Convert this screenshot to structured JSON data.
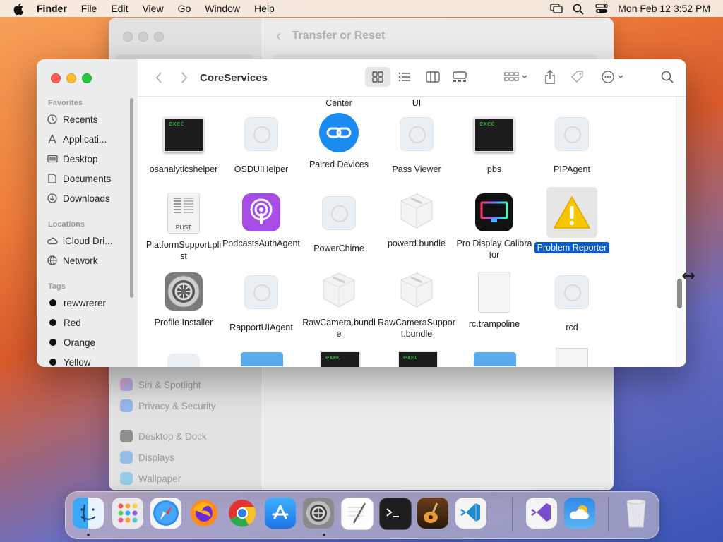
{
  "menubar": {
    "app_name": "Finder",
    "items": [
      "File",
      "Edit",
      "View",
      "Go",
      "Window",
      "Help"
    ],
    "clock": "Mon Feb 12  3:52 PM"
  },
  "settings_window": {
    "title": "Transfer or Reset",
    "sidebar_items": [
      {
        "label": "Siri & Spotlight",
        "color": "#c070e0"
      },
      {
        "label": "Privacy & Security",
        "color": "#4a8df0"
      },
      {
        "label": "Desktop & Dock",
        "color": "#2b2b2b"
      },
      {
        "label": "Displays",
        "color": "#3a8ef0"
      },
      {
        "label": "Wallpaper",
        "color": "#3ab0e8"
      }
    ]
  },
  "finder": {
    "title": "CoreServices",
    "sidebar": {
      "favorites_heading": "Favorites",
      "favorites": [
        {
          "label": "Recents",
          "icon": "clock-icon"
        },
        {
          "label": "Applicati...",
          "icon": "applications-icon"
        },
        {
          "label": "Desktop",
          "icon": "desktop-icon"
        },
        {
          "label": "Documents",
          "icon": "document-icon"
        },
        {
          "label": "Downloads",
          "icon": "download-icon"
        }
      ],
      "locations_heading": "Locations",
      "locations": [
        {
          "label": "iCloud Dri...",
          "icon": "cloud-icon"
        },
        {
          "label": "Network",
          "icon": "globe-icon"
        }
      ],
      "tags_heading": "Tags",
      "tags": [
        {
          "label": "rewwrerer",
          "color": "#111111"
        },
        {
          "label": "Red",
          "color": "#111111"
        },
        {
          "label": "Orange",
          "color": "#111111"
        },
        {
          "label": "Yellow",
          "color": "#111111"
        }
      ]
    },
    "partial_top_labels": [
      "Center",
      "UI"
    ],
    "rows": [
      [
        {
          "name": "osanalyticshelper",
          "type": "exec"
        },
        {
          "name": "OSDUIHelper",
          "type": "ghost"
        },
        {
          "name": "Paired Devices",
          "type": "paired"
        },
        {
          "name": "Pass Viewer",
          "type": "ghost"
        },
        {
          "name": "pbs",
          "type": "exec"
        },
        {
          "name": "PIPAgent",
          "type": "ghost"
        }
      ],
      [
        {
          "name": "PlatformSupport.plist",
          "type": "plist"
        },
        {
          "name": "PodcastsAuthAgent",
          "type": "podcasts"
        },
        {
          "name": "PowerChime",
          "type": "ghost"
        },
        {
          "name": "powerd.bundle",
          "type": "bundle"
        },
        {
          "name": "Pro Display Calibrator",
          "type": "prodisplay"
        },
        {
          "name": "Problem Reporter",
          "type": "warning",
          "selected": true
        }
      ],
      [
        {
          "name": "Profile Installer",
          "type": "gear"
        },
        {
          "name": "RapportUIAgent",
          "type": "ghost"
        },
        {
          "name": "RawCamera.bundle",
          "type": "bundle"
        },
        {
          "name": "RawCameraSupport.bundle",
          "type": "bundle"
        },
        {
          "name": "rc.trampoline",
          "type": "doc"
        },
        {
          "name": "rcd",
          "type": "ghost"
        }
      ]
    ],
    "exec_label": "exec",
    "plist_label": "PLIST"
  },
  "dock": {
    "apps": [
      "Finder",
      "Launchpad",
      "Safari",
      "Firefox",
      "Chrome",
      "App Store",
      "System Settings",
      "TextEdit",
      "Terminal",
      "GarageBand",
      "Visual Studio Code",
      "Visual Studio",
      "Weather",
      "Trash"
    ]
  }
}
